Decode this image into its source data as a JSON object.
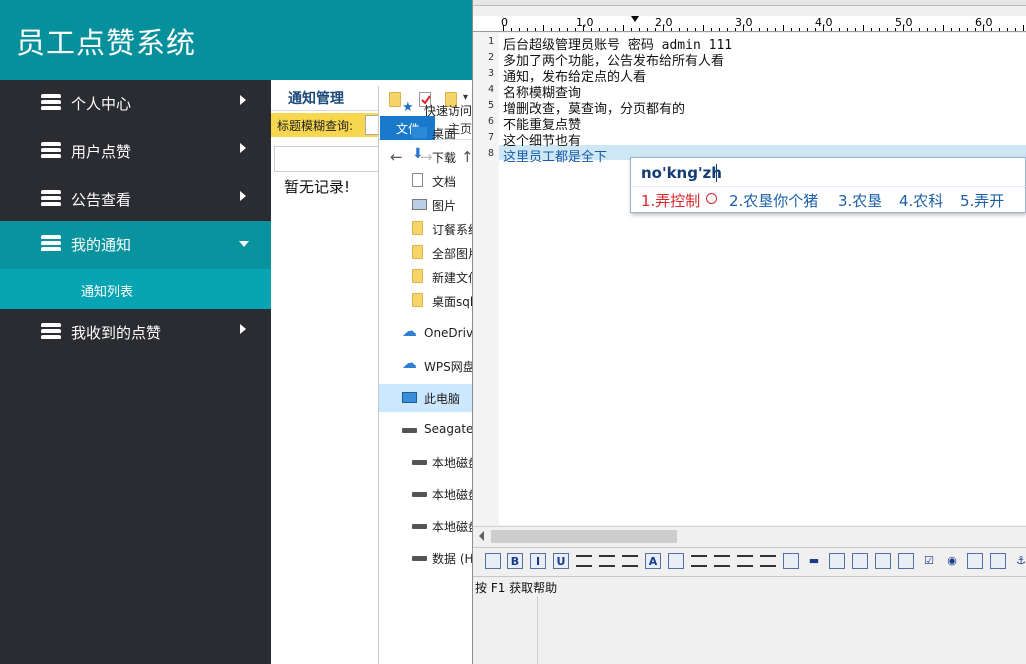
{
  "app": {
    "title": "员工点赞系统",
    "nav": [
      {
        "label": "个人中心"
      },
      {
        "label": "用户点赞"
      },
      {
        "label": "公告查看"
      },
      {
        "label": "我的通知"
      },
      {
        "label": "我收到的点赞"
      }
    ],
    "sub_item": "通知列表",
    "tab": "通知管理",
    "search_label": "标题模糊查询:",
    "empty_message": "暂无记录!"
  },
  "explorer": {
    "ribbon_file": "文件",
    "ribbon_home": "主页",
    "tree": [
      {
        "label": "快速访问",
        "icon": "star-icon"
      },
      {
        "label": "桌面",
        "icon": "desktop-icon"
      },
      {
        "label": "下载",
        "icon": "download-icon"
      },
      {
        "label": "文档",
        "icon": "document-icon"
      },
      {
        "label": "图片",
        "icon": "picture-icon"
      },
      {
        "label": "订餐系统",
        "icon": "folder-icon"
      },
      {
        "label": "全部图片",
        "icon": "folder-icon"
      },
      {
        "label": "新建文件",
        "icon": "folder-icon"
      },
      {
        "label": "桌面sql",
        "icon": "folder-icon"
      },
      {
        "label": "OneDrive",
        "icon": "cloud-icon"
      },
      {
        "label": "WPS网盘",
        "icon": "cloud-icon"
      },
      {
        "label": "此电脑",
        "icon": "computer-icon"
      },
      {
        "label": "Seagate",
        "icon": "drive-icon"
      },
      {
        "label": "本地磁盘",
        "icon": "drive-icon"
      },
      {
        "label": "本地磁盘",
        "icon": "drive-icon"
      },
      {
        "label": "本地磁盘 (L:)",
        "icon": "drive-icon"
      },
      {
        "label": "数据 (H:)",
        "icon": "drive-icon"
      }
    ]
  },
  "editor": {
    "ruler": [
      "0",
      "1,0",
      "2,0",
      "3,0",
      "4,0",
      "5,0",
      "6,0"
    ],
    "lines": [
      {
        "num": "1",
        "text": "后台超级管理员账号  密码 admin 111"
      },
      {
        "num": "2",
        "text": "多加了两个功能，公告发布给所有人看"
      },
      {
        "num": "3",
        "text": "通知，发布给定点的人看"
      },
      {
        "num": "4",
        "text": "名称模糊查询"
      },
      {
        "num": "5",
        "text": "增删改查，莫查询，分页都有的"
      },
      {
        "num": "6",
        "text": "不能重复点赞"
      },
      {
        "num": "7",
        "text": "这个细节也有"
      },
      {
        "num": "8",
        "text": "这里员工都是全下"
      }
    ],
    "toolbar": [
      "B",
      "I",
      "U",
      "A"
    ],
    "status": "按 F1 获取帮助"
  },
  "ime": {
    "composition": "no'kng'zh",
    "candidates": [
      "1.弄控制",
      "2.农垦你个猪",
      "3.农垦",
      "4.农科",
      "5.弄开"
    ]
  }
}
